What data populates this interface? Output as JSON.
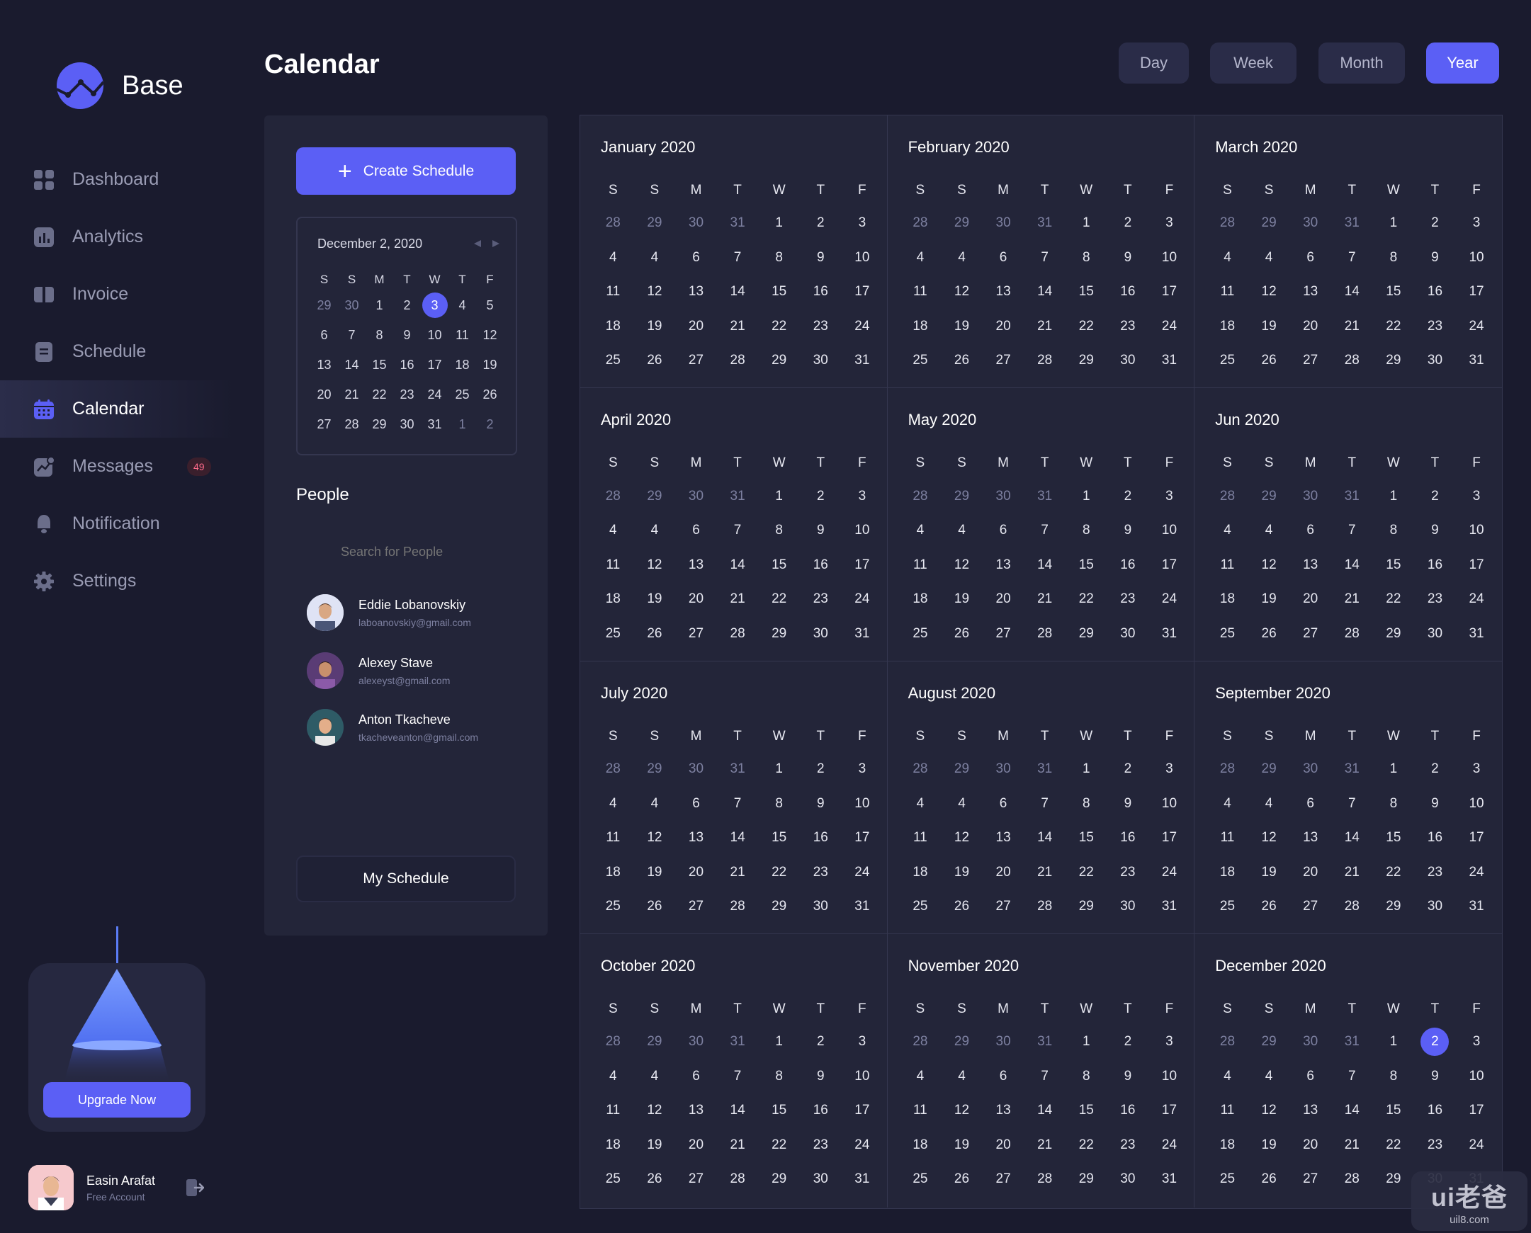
{
  "brand": {
    "name": "Base"
  },
  "sidebar": {
    "items": [
      {
        "label": "Dashboard",
        "icon": "grid-icon"
      },
      {
        "label": "Analytics",
        "icon": "bar-chart-icon"
      },
      {
        "label": "Invoice",
        "icon": "invoice-icon"
      },
      {
        "label": "Schedule",
        "icon": "document-icon"
      },
      {
        "label": "Calendar",
        "icon": "calendar-icon",
        "active": true
      },
      {
        "label": "Messages",
        "icon": "chart-message-icon",
        "badge": "49"
      },
      {
        "label": "Notification",
        "icon": "bell-icon"
      },
      {
        "label": "Settings",
        "icon": "gear-icon"
      }
    ],
    "upgrade_label": "Upgrade Now",
    "user": {
      "name": "Easin Arafat",
      "plan": "Free Account"
    }
  },
  "header": {
    "title": "Calendar",
    "views": [
      {
        "label": "Day"
      },
      {
        "label": "Week"
      },
      {
        "label": "Month"
      },
      {
        "label": "Year",
        "active": true
      }
    ]
  },
  "panel": {
    "create_label": "Create Schedule",
    "mini_calendar": {
      "date_label": "December 2, 2020",
      "weekdays": [
        "S",
        "S",
        "M",
        "T",
        "W",
        "T",
        "F"
      ],
      "weeks": [
        [
          "29",
          "30",
          "1",
          "2",
          "3",
          "4",
          "5"
        ],
        [
          "6",
          "7",
          "8",
          "9",
          "10",
          "11",
          "12"
        ],
        [
          "13",
          "14",
          "15",
          "16",
          "17",
          "18",
          "19"
        ],
        [
          "20",
          "21",
          "22",
          "23",
          "24",
          "25",
          "26"
        ],
        [
          "27",
          "28",
          "29",
          "30",
          "31",
          "1",
          "2"
        ]
      ],
      "selected": "3"
    },
    "people_title": "People",
    "search_placeholder": "Search for People",
    "people": [
      {
        "name": "Eddie Lobanovskiy",
        "email": "laboanovskiy@gmail.com"
      },
      {
        "name": "Alexey Stave",
        "email": "alexeyst@gmail.com"
      },
      {
        "name": "Anton Tkacheve",
        "email": "tkacheveanton@gmail.com"
      }
    ],
    "my_schedule_label": "My Schedule"
  },
  "year_view": {
    "weekdays": [
      "S",
      "S",
      "M",
      "T",
      "W",
      "T",
      "F"
    ],
    "weeks": [
      [
        "28",
        "29",
        "30",
        "31",
        "1",
        "2",
        "3"
      ],
      [
        "4",
        "4",
        "6",
        "7",
        "8",
        "9",
        "10"
      ],
      [
        "11",
        "12",
        "13",
        "14",
        "15",
        "16",
        "17"
      ],
      [
        "18",
        "19",
        "20",
        "21",
        "22",
        "23",
        "24"
      ],
      [
        "25",
        "26",
        "27",
        "28",
        "29",
        "30",
        "31"
      ]
    ],
    "muted_first_row": 4,
    "months": [
      {
        "title": "January  2020"
      },
      {
        "title": "February  2020"
      },
      {
        "title": "March  2020"
      },
      {
        "title": "April  2020"
      },
      {
        "title": "May  2020"
      },
      {
        "title": "Jun  2020"
      },
      {
        "title": "July  2020"
      },
      {
        "title": "August  2020"
      },
      {
        "title": "September  2020"
      },
      {
        "title": "October  2020"
      },
      {
        "title": "November  2020"
      },
      {
        "title": "December  2020",
        "selected": "2"
      }
    ]
  },
  "watermark": {
    "main": "ui老爸",
    "sub": "uil8.com"
  },
  "colors": {
    "accent": "#5b5ff5",
    "background": "#1a1b2e",
    "panel": "#232539"
  }
}
